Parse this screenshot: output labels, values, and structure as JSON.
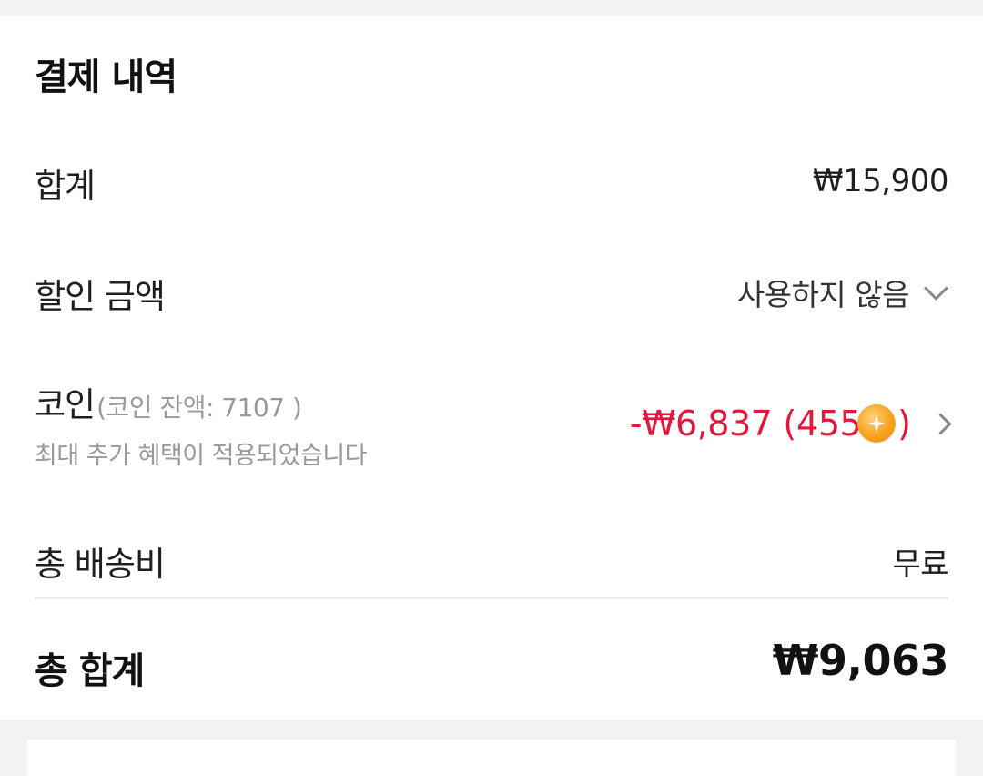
{
  "section": {
    "title": "결제 내역"
  },
  "subtotal": {
    "label": "합계",
    "value": "₩15,900"
  },
  "discount": {
    "label": "할인 금액",
    "selected": "사용하지 않음"
  },
  "coin": {
    "label": "코인",
    "balance": "(코인 잔액: 7107 )",
    "note": "최대 추가 혜택이 적용되었습니다",
    "value": "-₩6,837",
    "amount": "455",
    "paren_open": "(",
    "paren_close": ")"
  },
  "shipping": {
    "label": "총 배송비",
    "value": "무료"
  },
  "total": {
    "label": "총 합계",
    "value": "₩9,063"
  },
  "colors": {
    "accent_red": "#e0193c",
    "coin_orange": "#f7a21d"
  },
  "icons": {
    "discount_dropdown": "chevron-down-icon",
    "coin": "coin-icon",
    "coin_detail": "chevron-right-icon"
  }
}
